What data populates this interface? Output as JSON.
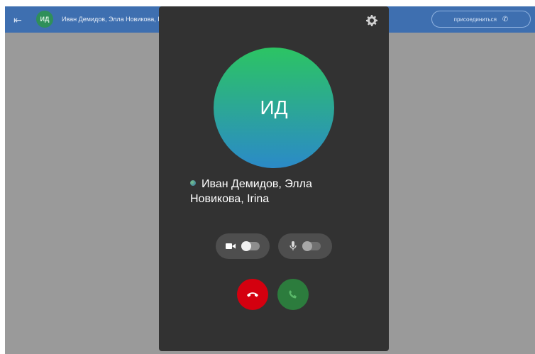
{
  "topbar": {
    "avatar_initials": "ИД",
    "chat_title": "Иван Демидов, Элла Новикова, Irina",
    "join_label": "присоединиться"
  },
  "call": {
    "avatar_initials": "ИД",
    "participants_line1": "Иван Демидов, Элла",
    "participants_line2": "Новикова, Irina",
    "camera_enabled": false,
    "mic_enabled": false
  },
  "colors": {
    "topbar": "#3e6fb0",
    "panel": "#323232",
    "decline": "#d4000f",
    "accept": "#2c7c3d"
  }
}
